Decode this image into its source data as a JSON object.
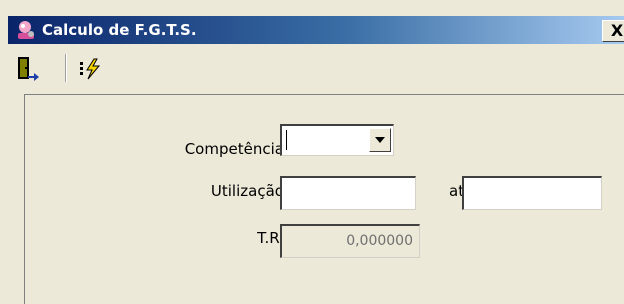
{
  "window": {
    "title": "Calculo de F.G.T.S.",
    "close_glyph": "X"
  },
  "toolbar": {
    "buttons": [
      {
        "icon": "exit-door-icon"
      },
      {
        "icon": "calculate-lightning-icon"
      }
    ]
  },
  "form": {
    "competencia_label": "Competência:",
    "competencia_value": "",
    "utilizacao_label": "Utilização:",
    "utilizacao_from": "",
    "ate_label": "até",
    "utilizacao_to": "",
    "tr_label": "T.R.:",
    "tr_value": "0,000000"
  },
  "colors": {
    "titlebar_start": "#0a246a",
    "titlebar_end": "#a6caf0",
    "face": "#ece9d8"
  }
}
